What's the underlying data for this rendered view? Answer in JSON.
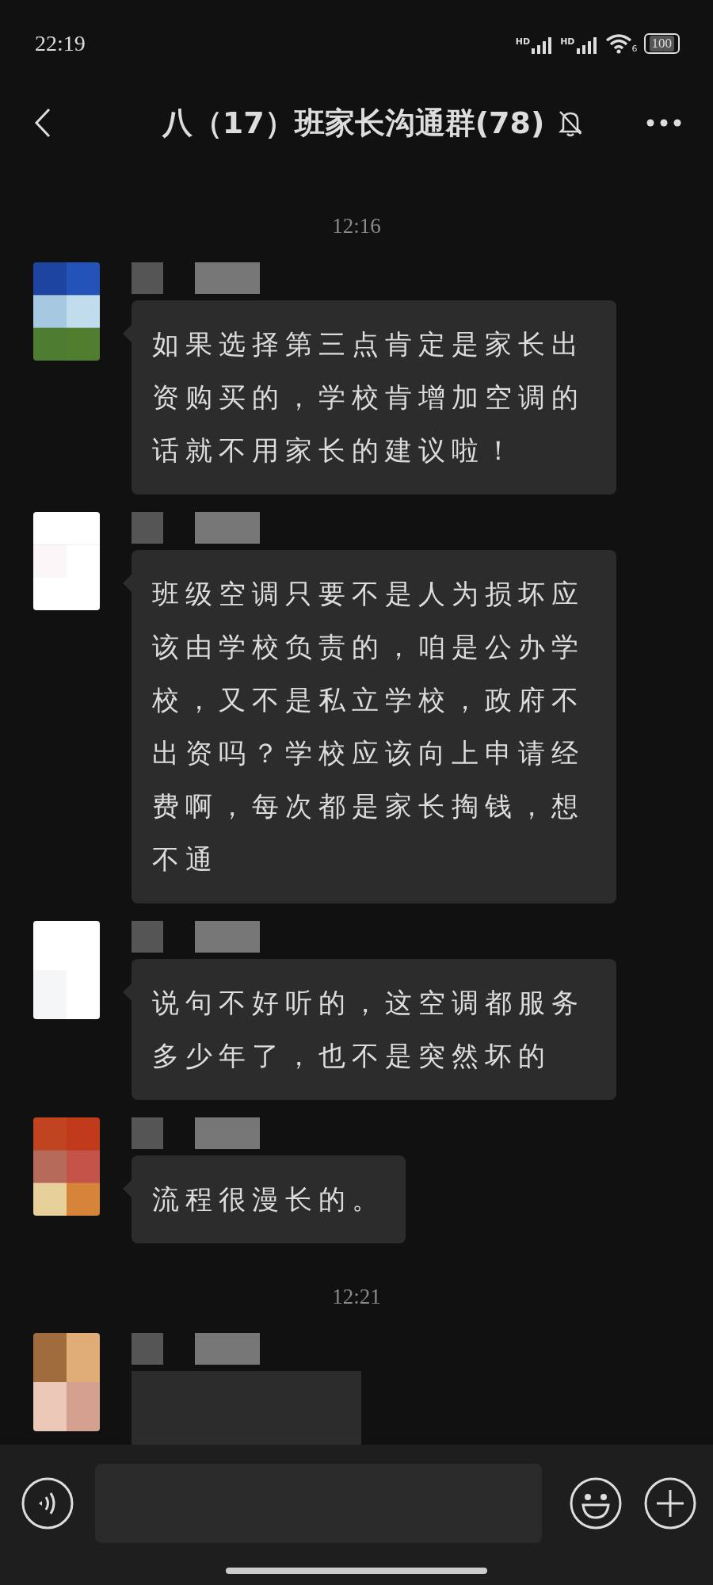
{
  "status_bar": {
    "time": "22:19",
    "signal_labels": [
      "HD",
      "HD"
    ],
    "wifi_badge": "6",
    "battery": "100"
  },
  "header": {
    "title": "八（17）班家长沟通群(78)",
    "muted": true
  },
  "messages": [
    {
      "kind": "time",
      "text": "12:16"
    },
    {
      "kind": "text",
      "text": "如果选择第三点肯定是家长出资购买的，学校肯增加空调的话就不用家长的建议啦！"
    },
    {
      "kind": "text",
      "text": "班级空调只要不是人为损坏应该由学校负责的，咱是公办学校，又不是私立学校，政府不出资吗？学校应该向上申请经费啊，每次都是家长掏钱，想不通"
    },
    {
      "kind": "text",
      "text": "说句不好听的，这空调都服务多少年了，也不是突然坏的"
    },
    {
      "kind": "text",
      "text": "流程很漫长的。"
    },
    {
      "kind": "time",
      "text": "12:21"
    },
    {
      "kind": "blurred"
    }
  ]
}
